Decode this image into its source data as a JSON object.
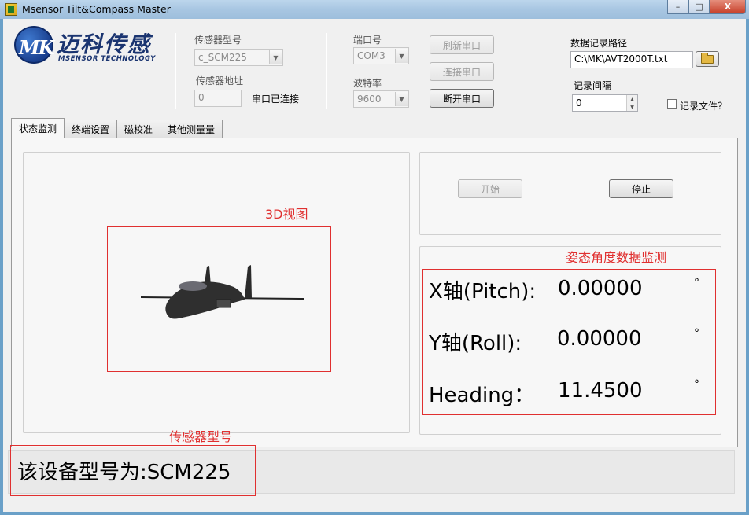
{
  "window": {
    "title": "Msensor Tilt&Compass Master",
    "controls": {
      "minimize": "–",
      "maximize": "□",
      "close": "X"
    }
  },
  "logo": {
    "mark": "MK",
    "name_cn": "迈科传感",
    "name_en": "MSENSOR TECHNOLOGY"
  },
  "sensor": {
    "model_label": "传感器型号",
    "model_value": "c_SCM225",
    "address_label": "传感器地址",
    "address_value": "0",
    "status_text": "串口已连接"
  },
  "serial": {
    "port_label": "端口号",
    "port_value": "COM3",
    "baud_label": "波特率",
    "baud_value": "9600",
    "refresh_button": "刷新串口",
    "connect_button": "连接串口",
    "disconnect_button": "断开串口"
  },
  "logging": {
    "path_label": "数据记录路径",
    "path_value": "C:\\MK\\AVT2000T.txt",
    "interval_label": "记录间隔",
    "interval_value": "0",
    "record_file_label": "记录文件？"
  },
  "tabs": [
    "状态监测",
    "终端设置",
    "磁校准",
    "其他测量量"
  ],
  "monitor": {
    "start_button": "开始",
    "stop_button": "停止",
    "view3d_label": "3D视图",
    "attitude_label": "姿态角度数据监测",
    "sensor_model_label": "传感器型号",
    "x_label": "X轴(Pitch):",
    "x_value": "0.00000",
    "y_label": "Y轴(Roll):",
    "y_value": "0.00000",
    "heading_label": "Heading：",
    "heading_value": "11.4500",
    "degree_symbol": "°",
    "model_text": "该设备型号为:SCM225"
  }
}
